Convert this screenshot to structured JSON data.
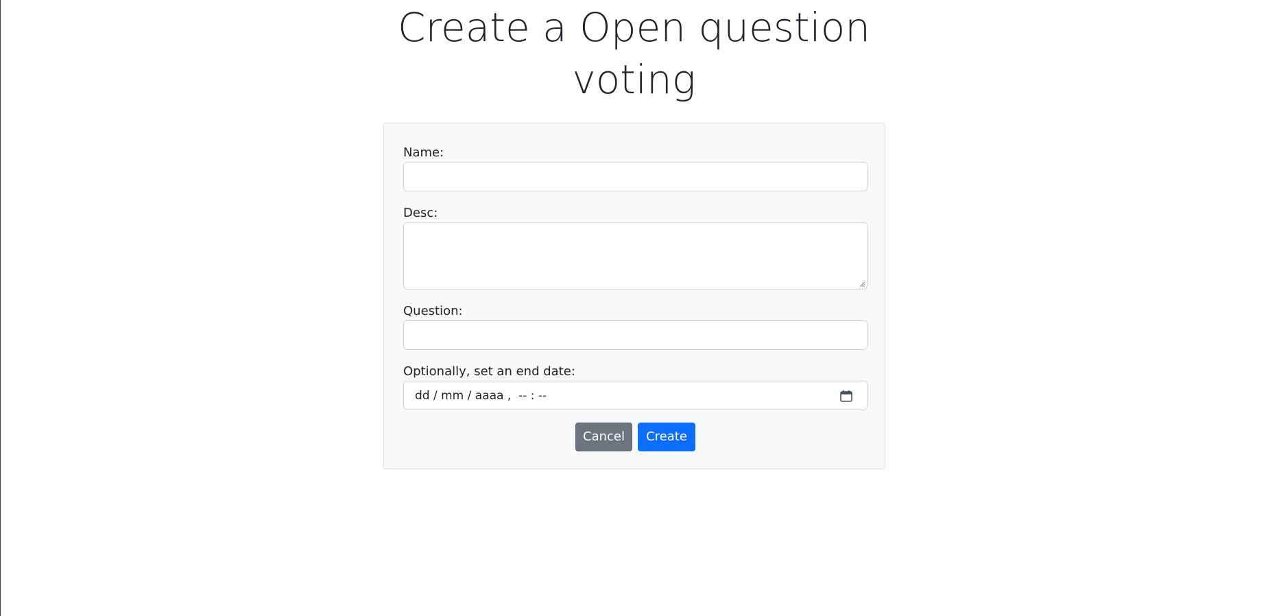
{
  "page": {
    "title_line1": "Create a Open question",
    "title_line2": "voting"
  },
  "form": {
    "name": {
      "label": "Name:",
      "value": "",
      "placeholder": ""
    },
    "desc": {
      "label": "Desc:",
      "value": "",
      "placeholder": ""
    },
    "question": {
      "label": "Question:",
      "value": "",
      "placeholder": ""
    },
    "end_date": {
      "label": "Optionally, set an end date:",
      "display": "dd / mm / aaaa ,  -- : --",
      "icon": "calendar-icon"
    },
    "buttons": {
      "cancel_label": "Cancel",
      "create_label": "Create"
    }
  },
  "colors": {
    "card_bg": "#f8f9fa",
    "cancel_bg": "#6c757d",
    "create_bg": "#0d6efd",
    "text": "#212529"
  }
}
